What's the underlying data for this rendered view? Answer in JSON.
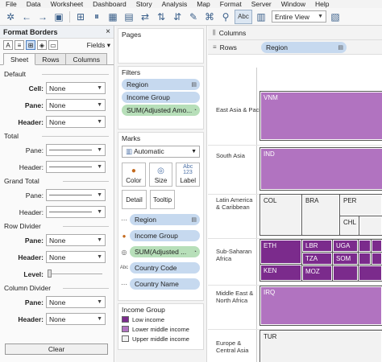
{
  "menu": [
    "File",
    "Data",
    "Worksheet",
    "Dashboard",
    "Story",
    "Analysis",
    "Map",
    "Format",
    "Server",
    "Window",
    "Help"
  ],
  "toolbar": {
    "fit_label": "Abc",
    "view_select": "Entire View"
  },
  "format_pane": {
    "title": "Format Borders",
    "fields_label": "Fields",
    "tabs": [
      "Sheet",
      "Rows",
      "Columns"
    ],
    "sections": {
      "default": "Default",
      "total": "Total",
      "grand_total": "Grand Total",
      "row_divider": "Row Divider",
      "column_divider": "Column Divider"
    },
    "labels": {
      "cell": "Cell:",
      "pane": "Pane:",
      "header": "Header:",
      "level": "Level:"
    },
    "values": {
      "default_cell": "None",
      "default_pane": "None",
      "default_header": "None",
      "row_pane": "None",
      "row_header": "None",
      "col_pane": "None",
      "col_header": "None"
    },
    "clear_label": "Clear"
  },
  "shelves": {
    "pages_title": "Pages",
    "filters_title": "Filters",
    "filters": [
      "Region",
      "Income Group",
      "SUM(Adjusted Amo..."
    ],
    "marks_title": "Marks",
    "marks_type": "Automatic",
    "mark_buttons": [
      "Color",
      "Size",
      "Label",
      "Detail",
      "Tooltip"
    ],
    "mark_fields": [
      "Region",
      "Income Group",
      "SUM(Adjusted ...",
      "Country Code",
      "Country Name"
    ],
    "legend_title": "Income Group",
    "legend": [
      {
        "label": "Low income",
        "color": "#7b2b8c"
      },
      {
        "label": "Lower middle income",
        "color": "#b173c0"
      },
      {
        "label": "Upper middle income",
        "color": "#f2f2f2"
      }
    ]
  },
  "viz": {
    "columns_label": "Columns",
    "rows_label": "Rows",
    "rows_pill": "Region",
    "regions": [
      "East Asia & Pacific",
      "South Asia",
      "Latin America & Caribbean",
      "Sub-Saharan Africa",
      "Middle East & North Africa",
      "Europe & Central Asia"
    ],
    "tiles": [
      "VNM",
      "IND",
      "COL",
      "BRA",
      "PER",
      "CHL",
      "ETH",
      "LBR",
      "UGA",
      "TZA",
      "SOM",
      "KEN",
      "MOZ",
      "IRQ",
      "TUR"
    ]
  },
  "colors": {
    "low_income": "#7b2b8c",
    "lower_middle": "#b173c0",
    "upper_middle": "#f2f2f2",
    "pill_blue": "#c6d9ef",
    "pill_green": "#b7dfb9"
  }
}
